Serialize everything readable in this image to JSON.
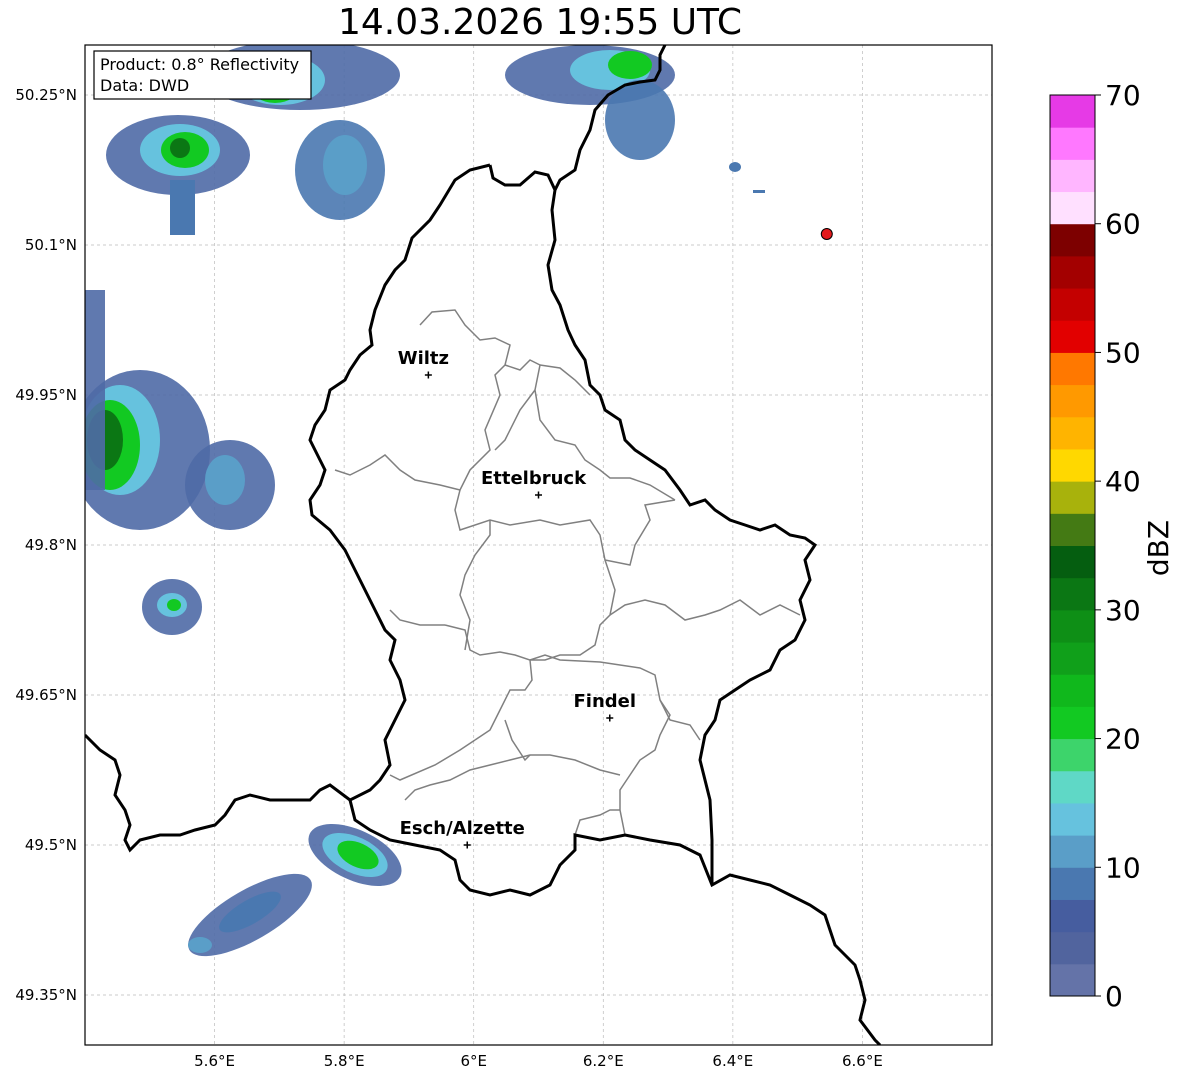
{
  "title": "14.03.2026 19:55 UTC",
  "info_box": {
    "product": "Product: 0.8° Reflectivity",
    "data": "Data: DWD"
  },
  "map": {
    "lon_range": [
      5.4,
      6.8
    ],
    "lat_range": [
      49.3,
      50.3
    ],
    "x_ticks": [
      "5.6°E",
      "5.8°E",
      "6°E",
      "6.2°E",
      "6.4°E",
      "6.6°E"
    ],
    "x_tick_values": [
      5.6,
      5.8,
      6.0,
      6.2,
      6.4,
      6.6
    ],
    "y_ticks": [
      "50.25°N",
      "50.1°N",
      "49.95°N",
      "49.8°N",
      "49.65°N",
      "49.5°N",
      "49.35°N"
    ],
    "y_tick_values": [
      50.25,
      50.1,
      49.95,
      49.8,
      49.65,
      49.5,
      49.35
    ],
    "grid": true,
    "cities": [
      {
        "name": "Wiltz",
        "lon": 5.93,
        "lat": 49.97
      },
      {
        "name": "Ettelbruck",
        "lon": 6.1,
        "lat": 49.85
      },
      {
        "name": "Findel",
        "lon": 6.21,
        "lat": 49.627
      },
      {
        "name": "Esch/Alzette",
        "lon": 5.99,
        "lat": 49.5
      }
    ],
    "marker": {
      "lon": 6.545,
      "lat": 50.111,
      "color": "#e31a1c"
    }
  },
  "colorbar": {
    "label": "dBZ",
    "ticks": [
      "0",
      "10",
      "20",
      "30",
      "40",
      "50",
      "60",
      "70"
    ],
    "colors": [
      "#6473a8",
      "#51649e",
      "#465d9f",
      "#4a78b0",
      "#5a9ec8",
      "#66c2de",
      "#5fd8c6",
      "#3dd46b",
      "#12c922",
      "#10b81c",
      "#10a01a",
      "#0e8f16",
      "#0b7714",
      "#055e10",
      "#447a14",
      "#a8b20c",
      "#ffd800",
      "#ffb400",
      "#ff9900",
      "#ff7800",
      "#e20000",
      "#c40000",
      "#a30000",
      "#7d0000",
      "#ffe0ff",
      "#ffb6ff",
      "#ff78ff",
      "#e63ae6"
    ]
  },
  "legend_colors": {
    "border": "#000000",
    "district": "#808080",
    "grid": "#bbbbbb"
  }
}
